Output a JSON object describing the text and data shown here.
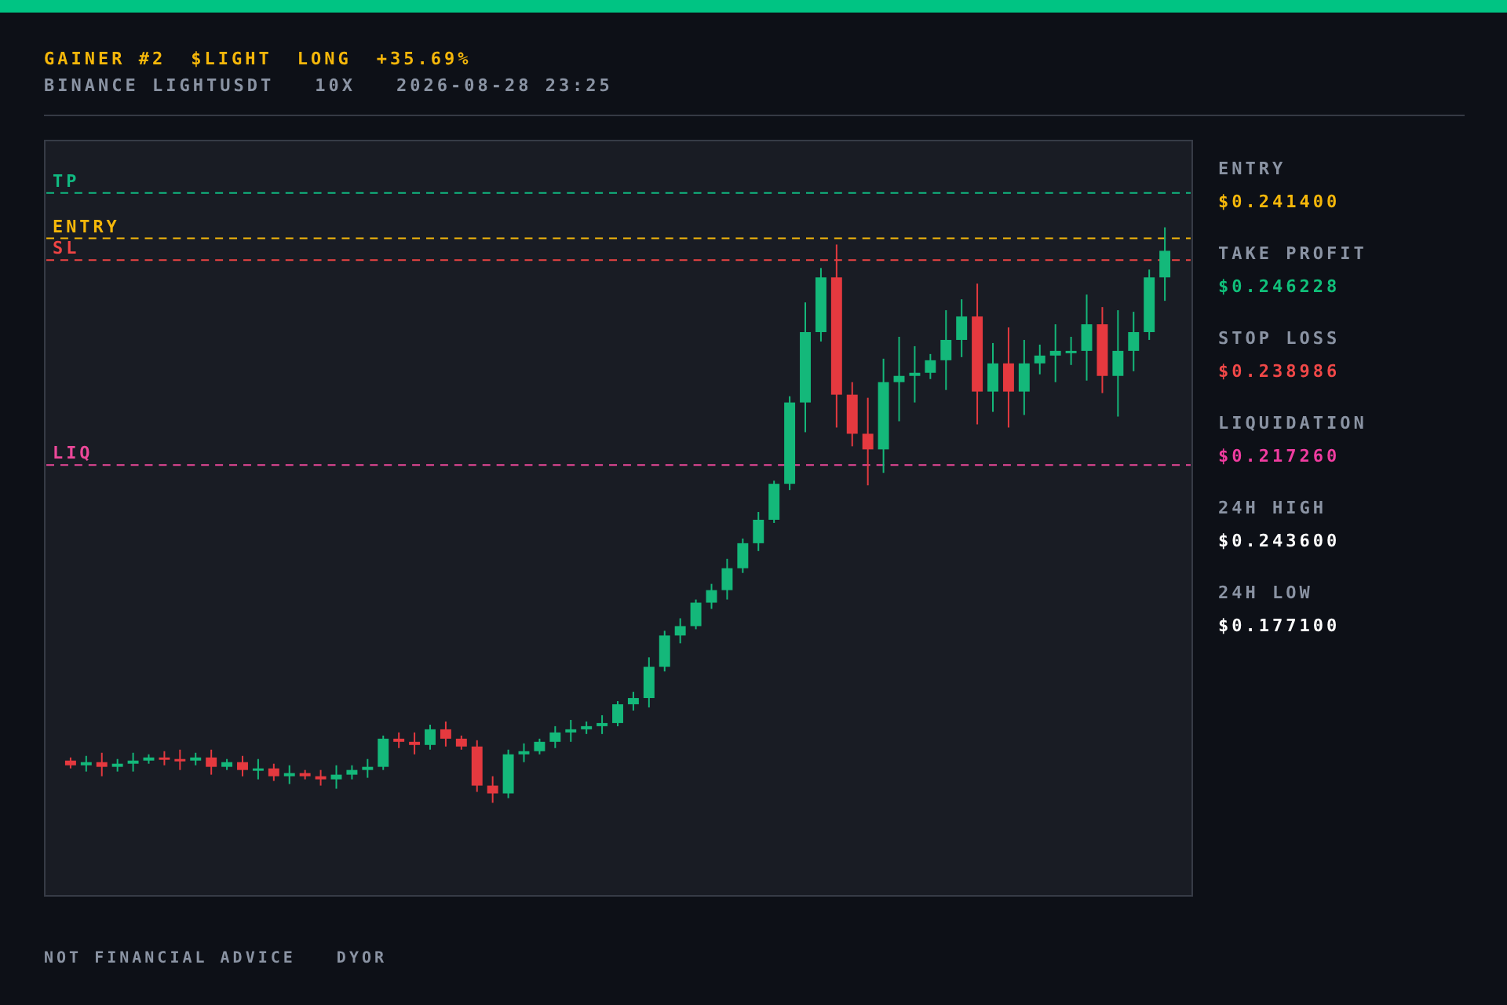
{
  "header": {
    "title": [
      "GAINER #2",
      "$LIGHT",
      "LONG",
      "+35.69%"
    ],
    "subtitle": [
      "BINANCE LIGHTUSDT",
      "10X",
      "2026-08-28 23:25"
    ]
  },
  "chart": {
    "levels": [
      {
        "kind": "tp",
        "label": "TP",
        "color": "#10b981"
      },
      {
        "kind": "entry",
        "label": "ENTRY",
        "color": "#f5b70a"
      },
      {
        "kind": "sl",
        "label": "SL",
        "color": "#ef4444"
      },
      {
        "kind": "liq",
        "label": "LIQ",
        "color": "#ec4899"
      }
    ]
  },
  "stats": [
    {
      "label": "ENTRY",
      "value": "$0.241400",
      "color": "#f5b70a"
    },
    {
      "label": "TAKE PROFIT",
      "value": "$0.246228",
      "color": "#10c07a"
    },
    {
      "label": "STOP LOSS",
      "value": "$0.238986",
      "color": "#f04848"
    },
    {
      "label": "LIQUIDATION",
      "value": "$0.217260",
      "color": "#f03ca0"
    },
    {
      "label": "24H HIGH",
      "value": "$0.243600",
      "color": "#ffffff"
    },
    {
      "label": "24H LOW",
      "value": "$0.177100",
      "color": "#ffffff"
    }
  ],
  "footer": [
    "NOT FINANCIAL ADVICE",
    "DYOR"
  ]
}
